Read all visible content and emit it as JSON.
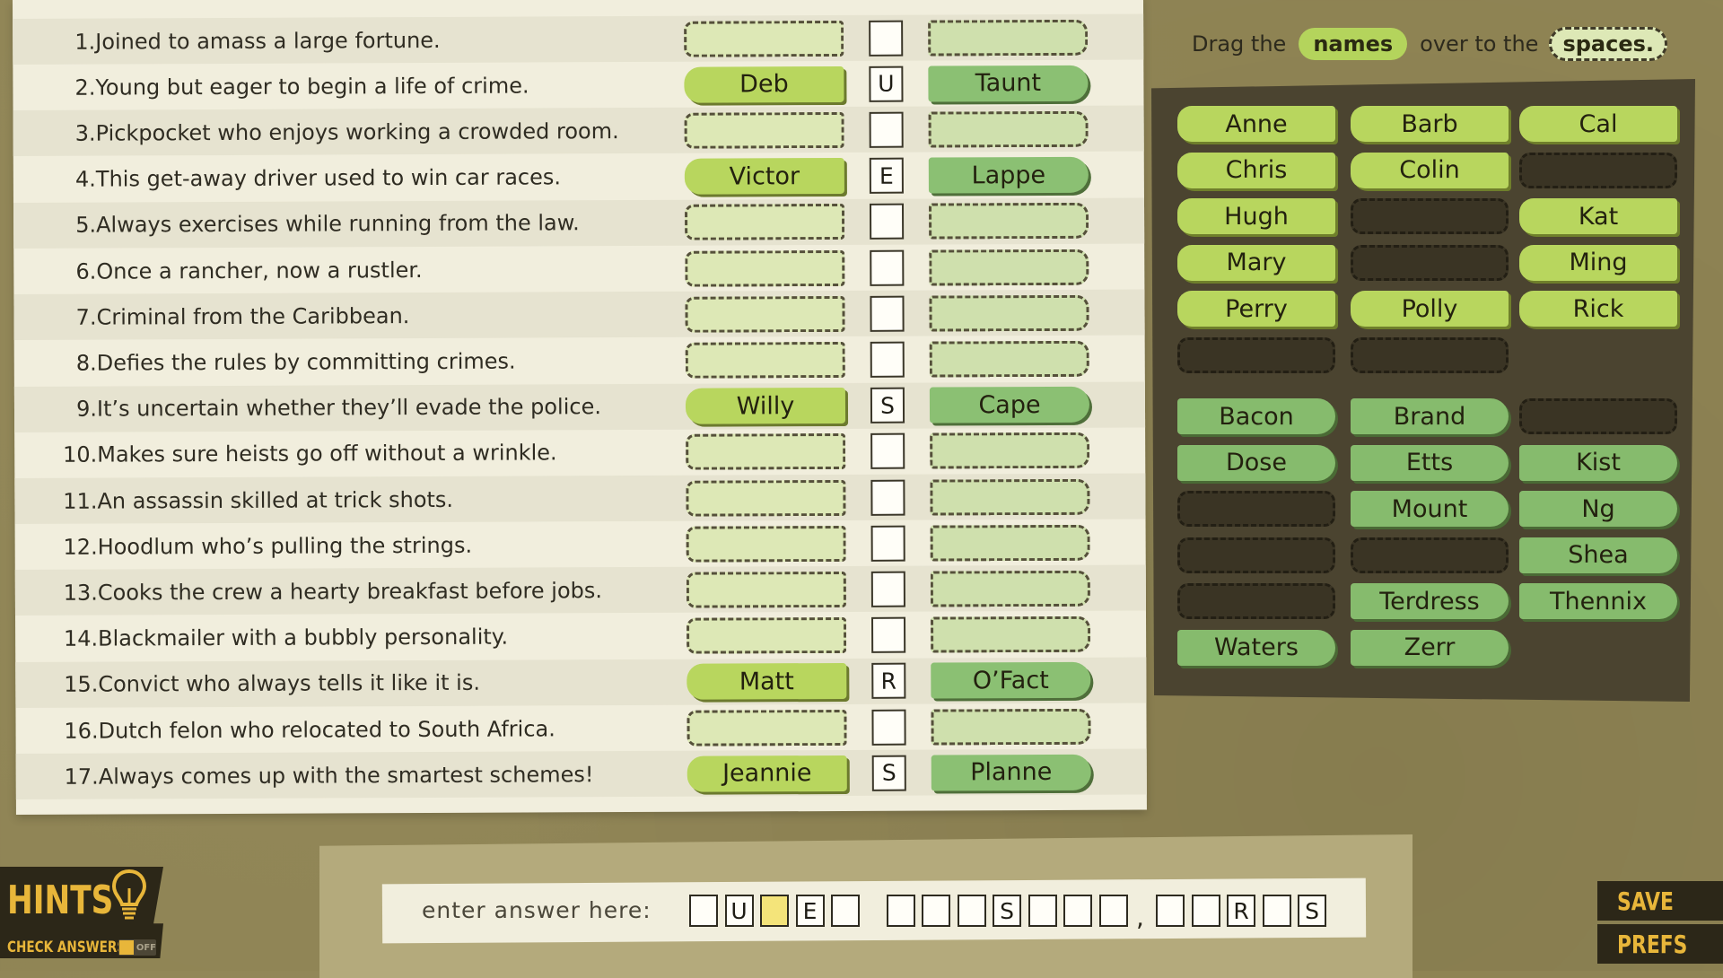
{
  "instructions": {
    "pre": "Drag the",
    "names": "names",
    "mid": "over to the",
    "spaces": "spaces."
  },
  "clues": [
    {
      "num": "1.",
      "text": "Joined to amass a large fortune.",
      "first": "",
      "letter": "",
      "last": ""
    },
    {
      "num": "2.",
      "text": "Young but eager to begin a life of crime.",
      "first": "Deb",
      "letter": "U",
      "last": "Taunt"
    },
    {
      "num": "3.",
      "text": "Pickpocket who enjoys working a crowded room.",
      "first": "",
      "letter": "",
      "last": ""
    },
    {
      "num": "4.",
      "text": "This get-away driver used to win car races.",
      "first": "Victor",
      "letter": "E",
      "last": "Lappe"
    },
    {
      "num": "5.",
      "text": "Always exercises while running from the law.",
      "first": "",
      "letter": "",
      "last": ""
    },
    {
      "num": "6.",
      "text": "Once a rancher, now a rustler.",
      "first": "",
      "letter": "",
      "last": ""
    },
    {
      "num": "7.",
      "text": "Criminal from the Caribbean.",
      "first": "",
      "letter": "",
      "last": ""
    },
    {
      "num": "8.",
      "text": "Defies the rules by committing crimes.",
      "first": "",
      "letter": "",
      "last": ""
    },
    {
      "num": "9.",
      "text": "It’s uncertain whether they’ll evade the police.",
      "first": "Willy",
      "letter": "S",
      "last": "Cape"
    },
    {
      "num": "10.",
      "text": "Makes sure heists go off without a wrinkle.",
      "first": "",
      "letter": "",
      "last": ""
    },
    {
      "num": "11.",
      "text": "An assassin skilled at trick shots.",
      "first": "",
      "letter": "",
      "last": ""
    },
    {
      "num": "12.",
      "text": "Hoodlum who’s pulling the strings.",
      "first": "",
      "letter": "",
      "last": ""
    },
    {
      "num": "13.",
      "text": "Cooks the crew a hearty breakfast before jobs.",
      "first": "",
      "letter": "",
      "last": ""
    },
    {
      "num": "14.",
      "text": "Blackmailer with a bubbly personality.",
      "first": "",
      "letter": "",
      "last": ""
    },
    {
      "num": "15.",
      "text": "Convict who always tells it like it is.",
      "first": "Matt",
      "letter": "R",
      "last": "O’Fact"
    },
    {
      "num": "16.",
      "text": "Dutch felon who relocated to South Africa.",
      "first": "",
      "letter": "",
      "last": ""
    },
    {
      "num": "17.",
      "text": "Always comes up with the smartest schemes!",
      "first": "Jeannie",
      "letter": "S",
      "last": "Planne"
    }
  ],
  "first_names": [
    "Anne",
    "Barb",
    "Cal",
    "Chris",
    "Colin",
    "",
    "Hugh",
    "",
    "Kat",
    "Mary",
    "",
    "Ming",
    "Perry",
    "Polly",
    "Rick",
    "",
    ""
  ],
  "last_names": [
    "Bacon",
    "Brand",
    "",
    "Dose",
    "Etts",
    "Kist",
    "",
    "Mount",
    "Ng",
    "",
    "",
    "Shea",
    "",
    "Terdress",
    "Thennix",
    "Waters",
    "Zerr"
  ],
  "answer": {
    "label": "enter answer here:",
    "groups": [
      [
        "",
        "U",
        "",
        "E",
        ""
      ],
      [
        "",
        "",
        "",
        "S",
        "",
        "",
        ""
      ],
      [
        "",
        "",
        "R",
        "",
        "S"
      ]
    ],
    "highlight_index": 2
  },
  "hints": {
    "label": "HINTS",
    "check_label": "CHECK ANSWERS",
    "toggle_state": "OFF"
  },
  "side_buttons": {
    "save": "SAVE",
    "prefs": "PREFS"
  },
  "colors": {
    "first_chip": "#b8d65e",
    "last_chip": "#86bb6d",
    "accent": "#e8b63a",
    "tray": "#4b4430",
    "paper": "#f1eedd"
  }
}
